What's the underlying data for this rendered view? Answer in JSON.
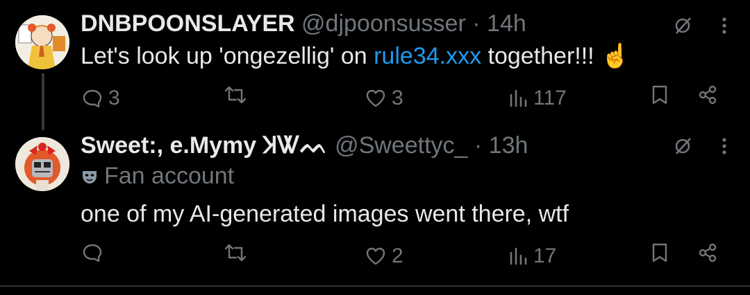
{
  "tweets": [
    {
      "display_name": "DNBPOONSLAYER",
      "handle": "@djpoonsusser",
      "separator": "·",
      "time": "14h",
      "text_before": "Let's look up 'ongezellig' on ",
      "link": "rule34.xxx",
      "text_after": " together!!! ",
      "emoji": "☝",
      "actions": {
        "replies": "3",
        "retweets": "",
        "likes": "3",
        "views": "117"
      }
    },
    {
      "display_name": "Sweet:, e.Mymy ꞰᏔᨓ",
      "handle": "@Sweettyc_",
      "separator": "·",
      "time": "13h",
      "label": "Fan account",
      "text": "one of my AI-generated images went there, wtf",
      "actions": {
        "replies": "",
        "retweets": "",
        "likes": "2",
        "views": "17"
      }
    }
  ],
  "colors": {
    "background": "#000000",
    "text": "#e7e9ea",
    "muted": "#71767b",
    "link": "#1d9bf0"
  }
}
